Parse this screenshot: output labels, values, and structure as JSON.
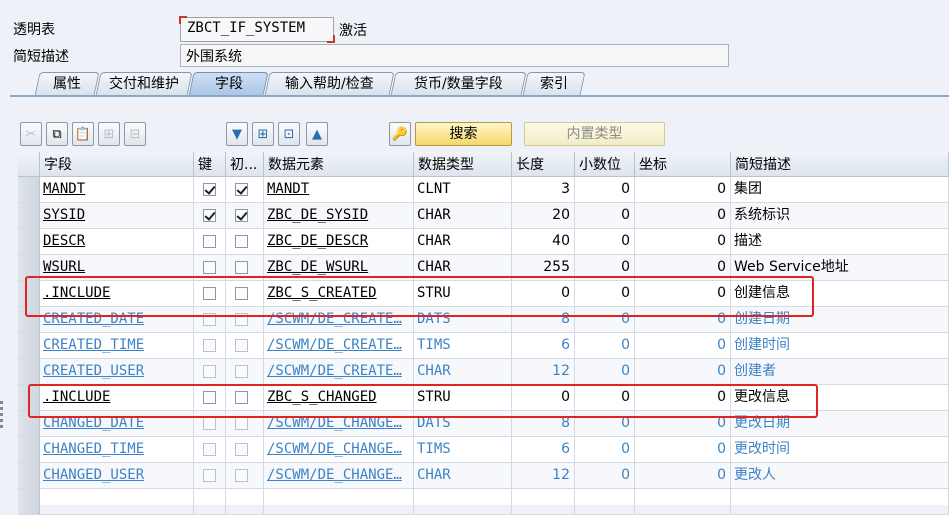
{
  "header": {
    "table_label": "透明表",
    "table_name": "ZBCT_IF_SYSTEM",
    "status": "激活",
    "desc_label": "简短描述",
    "desc_value": "外围系统"
  },
  "tabs": [
    {
      "label": "属性",
      "active": false
    },
    {
      "label": "交付和维护",
      "active": false
    },
    {
      "label": "字段",
      "active": true
    },
    {
      "label": "输入帮助/检查",
      "active": false
    },
    {
      "label": "货币/数量字段",
      "active": false
    },
    {
      "label": "索引",
      "active": false
    }
  ],
  "toolbar": {
    "icons": [
      "cut-icon",
      "copy-icon",
      "paste-icon",
      "insert-row-icon",
      "delete-row-icon",
      "expand-all-icon",
      "new-rows-icon",
      "collapse-icon",
      "move-up-icon",
      "key-icon"
    ],
    "search_label": "搜索",
    "builtin_label": "内置类型"
  },
  "columns": [
    "字段",
    "键",
    "初...",
    "数据元素",
    "数据类型",
    "长度",
    "小数位",
    "坐标",
    "简短描述"
  ],
  "rows": [
    {
      "field": "MANDT",
      "key": true,
      "init": true,
      "element": "MANDT",
      "type": "CLNT",
      "length": "3",
      "decimals": "0",
      "coord": "0",
      "desc": "集团",
      "sub": false
    },
    {
      "field": "SYSID",
      "key": true,
      "init": true,
      "element": "ZBC_DE_SYSID",
      "type": "CHAR",
      "length": "20",
      "decimals": "0",
      "coord": "0",
      "desc": "系统标识",
      "sub": false
    },
    {
      "field": "DESCR",
      "key": false,
      "init": false,
      "element": "ZBC_DE_DESCR",
      "type": "CHAR",
      "length": "40",
      "decimals": "0",
      "coord": "0",
      "desc": "描述",
      "sub": false
    },
    {
      "field": "WSURL",
      "key": false,
      "init": false,
      "element": "ZBC_DE_WSURL",
      "type": "CHAR",
      "length": "255",
      "decimals": "0",
      "coord": "0",
      "desc": "Web Service地址",
      "sub": false
    },
    {
      "field": ".INCLUDE",
      "key": false,
      "init": false,
      "element": "ZBC_S_CREATED",
      "type": "STRU",
      "length": "0",
      "decimals": "0",
      "coord": "0",
      "desc": "创建信息",
      "sub": false
    },
    {
      "field": "CREATED_DATE",
      "key": false,
      "init": false,
      "element": "/SCWM/DE_CREATE…",
      "type": "DATS",
      "length": "8",
      "decimals": "0",
      "coord": "0",
      "desc": "创建日期",
      "sub": true
    },
    {
      "field": "CREATED_TIME",
      "key": false,
      "init": false,
      "element": "/SCWM/DE_CREATE…",
      "type": "TIMS",
      "length": "6",
      "decimals": "0",
      "coord": "0",
      "desc": "创建时间",
      "sub": true
    },
    {
      "field": "CREATED_USER",
      "key": false,
      "init": false,
      "element": "/SCWM/DE_CREATE…",
      "type": "CHAR",
      "length": "12",
      "decimals": "0",
      "coord": "0",
      "desc": "创建者",
      "sub": true
    },
    {
      "field": ".INCLUDE",
      "key": false,
      "init": false,
      "element": "ZBC_S_CHANGED",
      "type": "STRU",
      "length": "0",
      "decimals": "0",
      "coord": "0",
      "desc": "更改信息",
      "sub": false
    },
    {
      "field": "CHANGED_DATE",
      "key": false,
      "init": false,
      "element": "/SCWM/DE_CHANGE…",
      "type": "DATS",
      "length": "8",
      "decimals": "0",
      "coord": "0",
      "desc": "更改日期",
      "sub": true
    },
    {
      "field": "CHANGED_TIME",
      "key": false,
      "init": false,
      "element": "/SCWM/DE_CHANGE…",
      "type": "TIMS",
      "length": "6",
      "decimals": "0",
      "coord": "0",
      "desc": "更改时间",
      "sub": true
    },
    {
      "field": "CHANGED_USER",
      "key": false,
      "init": false,
      "element": "/SCWM/DE_CHANGE…",
      "type": "CHAR",
      "length": "12",
      "decimals": "0",
      "coord": "0",
      "desc": "更改人",
      "sub": true
    }
  ],
  "colors": {
    "highlight": "#e02323",
    "link_sub": "#3d83c6",
    "search_button": "#f4d86a"
  }
}
